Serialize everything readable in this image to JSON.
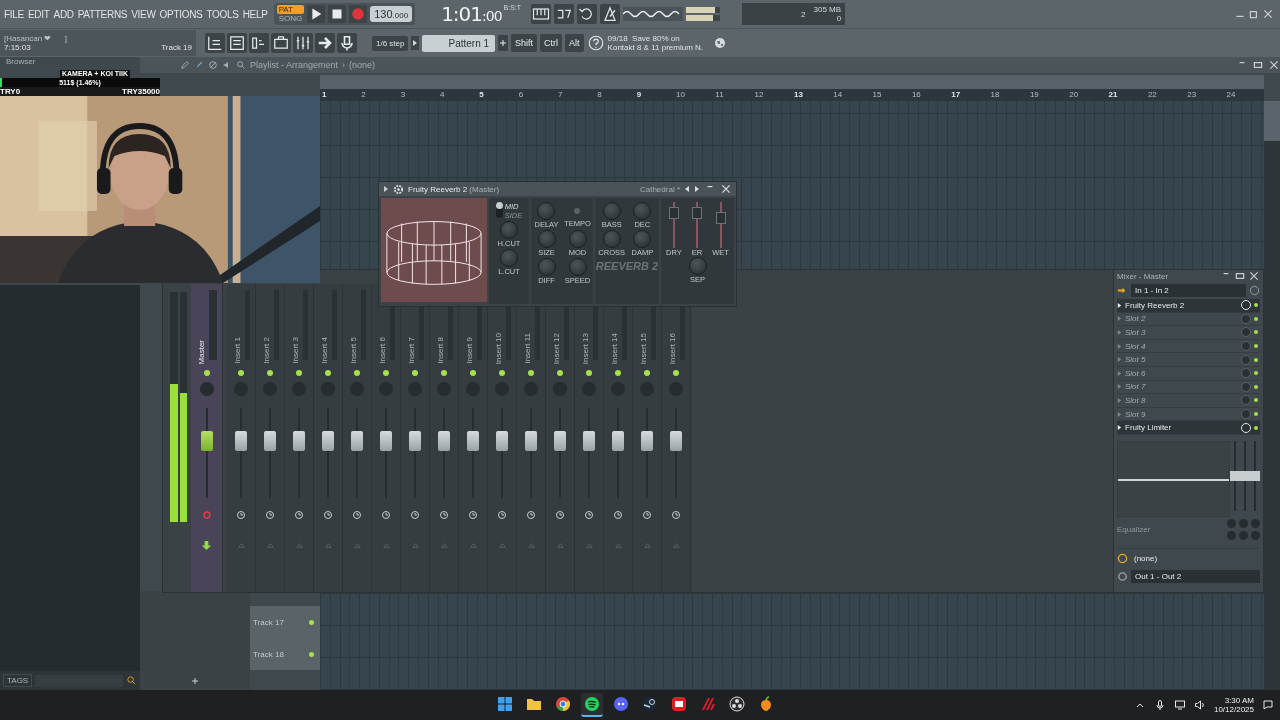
{
  "menu": [
    "FILE",
    "EDIT",
    "ADD",
    "PATTERNS",
    "VIEW",
    "OPTIONS",
    "TOOLS",
    "HELP"
  ],
  "transport": {
    "modes": [
      {
        "label": "PAT",
        "selected": true
      },
      {
        "label": "SONG",
        "selected": false
      }
    ],
    "tempo": "130",
    "tempo_fraction": ".000",
    "time": "1:01",
    "time_ticks": ":00",
    "time_format": "B:S:T",
    "master_sliders": [
      {
        "level": 0.85
      },
      {
        "level": 0.8
      }
    ]
  },
  "cpu": {
    "value": "2",
    "memory": "305 MB",
    "polyphony": "0"
  },
  "hint": {
    "user": "[Hasancan ❤      ]",
    "time": "7:15:03",
    "track": "Track 19"
  },
  "snap": "1/6 step",
  "pattern": "Pattern 1",
  "keys": [
    "Shift",
    "Ctrl",
    "Alt"
  ],
  "news": [
    "09/18  Save 80% on",
    "Kontakt 8 & 11 premium N."
  ],
  "browser": {
    "title": "Browser",
    "tags": "TAGS"
  },
  "playlist": {
    "title": "Playlist - Arrangement",
    "separator": "›",
    "pattern": "(none)",
    "bars": [
      "1",
      "2",
      "3",
      "4",
      "5",
      "6",
      "7",
      "8",
      "9",
      "10",
      "11",
      "12",
      "13",
      "14",
      "15",
      "16",
      "17",
      "18",
      "19",
      "20",
      "21",
      "22",
      "23",
      "24"
    ],
    "tracks": [
      "Track 17",
      "Track 18"
    ]
  },
  "stream": {
    "goal_title": "KAMERA + KOI TIIK",
    "goal_amount": "511$ (1.46%)",
    "level": 0.0146,
    "start": "TRY0",
    "target": "TRY35000"
  },
  "reverb": {
    "title": "Fruity Reeverb 2",
    "target": "(Master)",
    "preset": "Cathedral *",
    "stereo": [
      {
        "label": "MID",
        "selected": true
      },
      {
        "label": "SIDE",
        "selected": false
      }
    ],
    "groups": [
      [
        {
          "label": "H.CUT",
          "kind": "knob"
        },
        {
          "label": "L.CUT",
          "kind": "knob"
        }
      ],
      [
        {
          "label": "DELAY",
          "kind": "knob"
        },
        {
          "label": "TEMPO",
          "kind": "led"
        },
        {
          "label": "SIZE",
          "kind": "knob"
        },
        {
          "label": "MOD",
          "kind": "knob"
        },
        {
          "label": "DIFF",
          "kind": "knob"
        },
        {
          "label": "SPEED",
          "kind": "knob"
        }
      ],
      [
        {
          "label": "BASS",
          "kind": "knob"
        },
        {
          "label": "DEC",
          "kind": "knob"
        },
        {
          "label": "CROSS",
          "kind": "knob"
        },
        {
          "label": "DAMP",
          "kind": "knob"
        }
      ]
    ],
    "logo": "REEVERB 2",
    "faders": [
      {
        "label": "DRY",
        "level": 0.85
      },
      {
        "label": "ER",
        "level": 0.85
      },
      {
        "label": "WET",
        "level": 0.7
      }
    ],
    "sep": "SEP"
  },
  "mixer": {
    "title": "Mixer - Master",
    "master_meter": [
      {
        "level": 0.6
      },
      {
        "level": 0.56
      }
    ],
    "master": {
      "name": "Master",
      "level": 0.67
    },
    "inserts": [
      {
        "name": "Insert 1",
        "level": 0.67
      },
      {
        "name": "Insert 2",
        "level": 0.67
      },
      {
        "name": "Insert 3",
        "level": 0.67
      },
      {
        "name": "Insert 4",
        "level": 0.67
      },
      {
        "name": "Insert 5",
        "level": 0.67
      },
      {
        "name": "Insert 6",
        "level": 0.67
      },
      {
        "name": "Insert 7",
        "level": 0.67
      },
      {
        "name": "Insert 8",
        "level": 0.67
      },
      {
        "name": "Insert 9",
        "level": 0.67
      },
      {
        "name": "Insert 10",
        "level": 0.67
      },
      {
        "name": "Insert 11",
        "level": 0.67
      },
      {
        "name": "Insert 12",
        "level": 0.67
      },
      {
        "name": "Insert 13",
        "level": 0.67
      },
      {
        "name": "Insert 14",
        "level": 0.67
      },
      {
        "name": "Insert 15",
        "level": 0.67
      },
      {
        "name": "Insert 16",
        "level": 0.67
      }
    ],
    "input": "In 1 - In 2",
    "slots": [
      {
        "name": "Fruity Reeverb 2",
        "filled": true
      },
      {
        "name": "Slot 2",
        "filled": false
      },
      {
        "name": "Slot 3",
        "filled": false
      },
      {
        "name": "Slot 4",
        "filled": false
      },
      {
        "name": "Slot 5",
        "filled": false
      },
      {
        "name": "Slot 6",
        "filled": false
      },
      {
        "name": "Slot 7",
        "filled": false
      },
      {
        "name": "Slot 8",
        "filled": false
      },
      {
        "name": "Slot 9",
        "filled": false
      },
      {
        "name": "Fruity Limiter",
        "filled": true
      }
    ],
    "eq_label": "Equalizer",
    "eq_faders": [
      {
        "level": 0.5
      },
      {
        "level": 0.5
      },
      {
        "level": 0.5
      }
    ],
    "send": "(none)",
    "output": "Out 1 - Out 2"
  },
  "taskbar": {
    "apps": [
      {
        "kind": "start",
        "active": false
      },
      {
        "kind": "folder",
        "active": false
      },
      {
        "kind": "chrome",
        "active": false
      },
      {
        "kind": "spotify",
        "active": true
      },
      {
        "kind": "discord",
        "active": false
      },
      {
        "kind": "steam",
        "active": false
      },
      {
        "kind": "redapp",
        "active": false
      },
      {
        "kind": "stripes",
        "active": false
      },
      {
        "kind": "obs",
        "active": false
      },
      {
        "kind": "fl",
        "active": false
      }
    ],
    "time": "3:30 AM",
    "date": "10/12/2025"
  }
}
